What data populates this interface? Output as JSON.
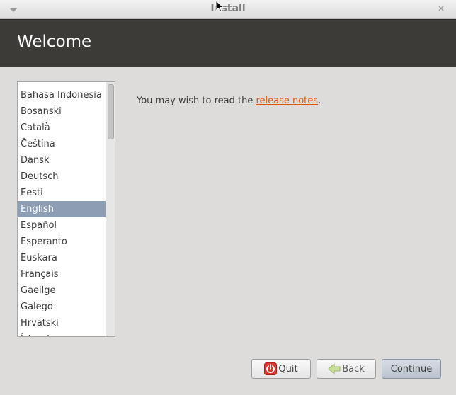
{
  "window": {
    "title": "Install"
  },
  "header": {
    "title": "Welcome"
  },
  "languages": {
    "items": [
      "Bahasa Indonesia",
      "Bosanski",
      "Català",
      "Čeština",
      "Dansk",
      "Deutsch",
      "Eesti",
      "English",
      "Español",
      "Esperanto",
      "Euskara",
      "Français",
      "Gaeilge",
      "Galego",
      "Hrvatski",
      "Íslenska"
    ],
    "selected": "English"
  },
  "release": {
    "prefix": "You may wish to read the ",
    "link_text": "release notes",
    "suffix": "."
  },
  "buttons": {
    "quit": "Quit",
    "back": "Back",
    "continue": "Continue"
  },
  "colors": {
    "header_bg": "#3c3b37",
    "selection": "#8d9eb4",
    "link": "#e0570c",
    "quit_icon": "#d9332a"
  },
  "icons": {
    "window_menu": "chevron-down-icon",
    "window_close": "close-icon",
    "quit": "power-icon",
    "back": "arrow-left-icon"
  }
}
